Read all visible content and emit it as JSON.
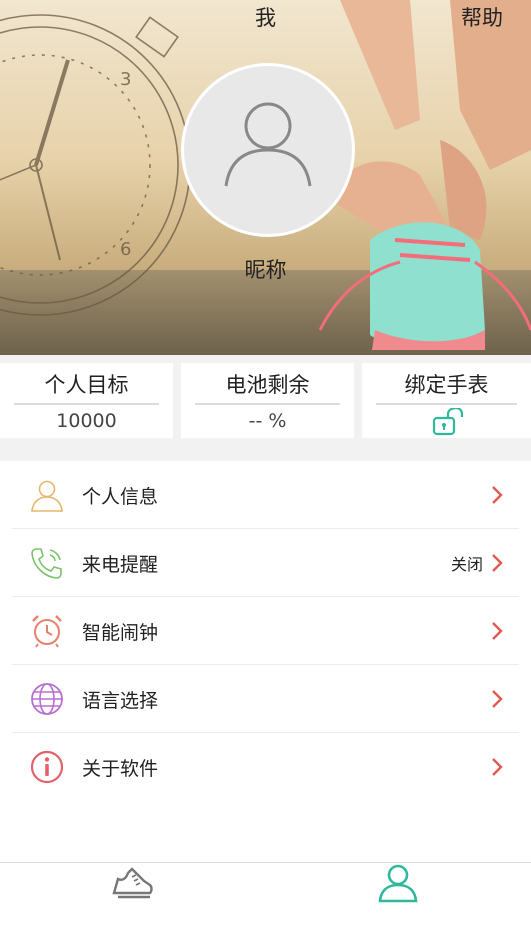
{
  "header": {
    "title": "我",
    "help": "帮助"
  },
  "profile": {
    "nickname": "昵称"
  },
  "stats": [
    {
      "label": "个人目标",
      "value": "10000"
    },
    {
      "label": "电池剩余",
      "value": "-- %"
    },
    {
      "label": "绑定手表",
      "icon": "unlock-icon"
    }
  ],
  "menu": [
    {
      "label": "个人信息",
      "icon": "user-icon",
      "status": ""
    },
    {
      "label": "来电提醒",
      "icon": "phone-icon",
      "status": "关闭"
    },
    {
      "label": "智能闹钟",
      "icon": "alarm-clock-icon",
      "status": ""
    },
    {
      "label": "语言选择",
      "icon": "globe-icon",
      "status": ""
    },
    {
      "label": "关于软件",
      "icon": "info-icon",
      "status": ""
    }
  ],
  "colors": {
    "accent": "#2fb89a",
    "arrow": "#e05a4e",
    "user_icon": "#e8b66a",
    "phone_icon": "#7cc36b",
    "alarm_icon": "#e7816f",
    "globe_icon": "#b86fd0",
    "info_icon": "#e4616b"
  },
  "tabbar": [
    {
      "icon": "running-shoe-icon",
      "active": false
    },
    {
      "icon": "person-icon",
      "active": true
    }
  ]
}
